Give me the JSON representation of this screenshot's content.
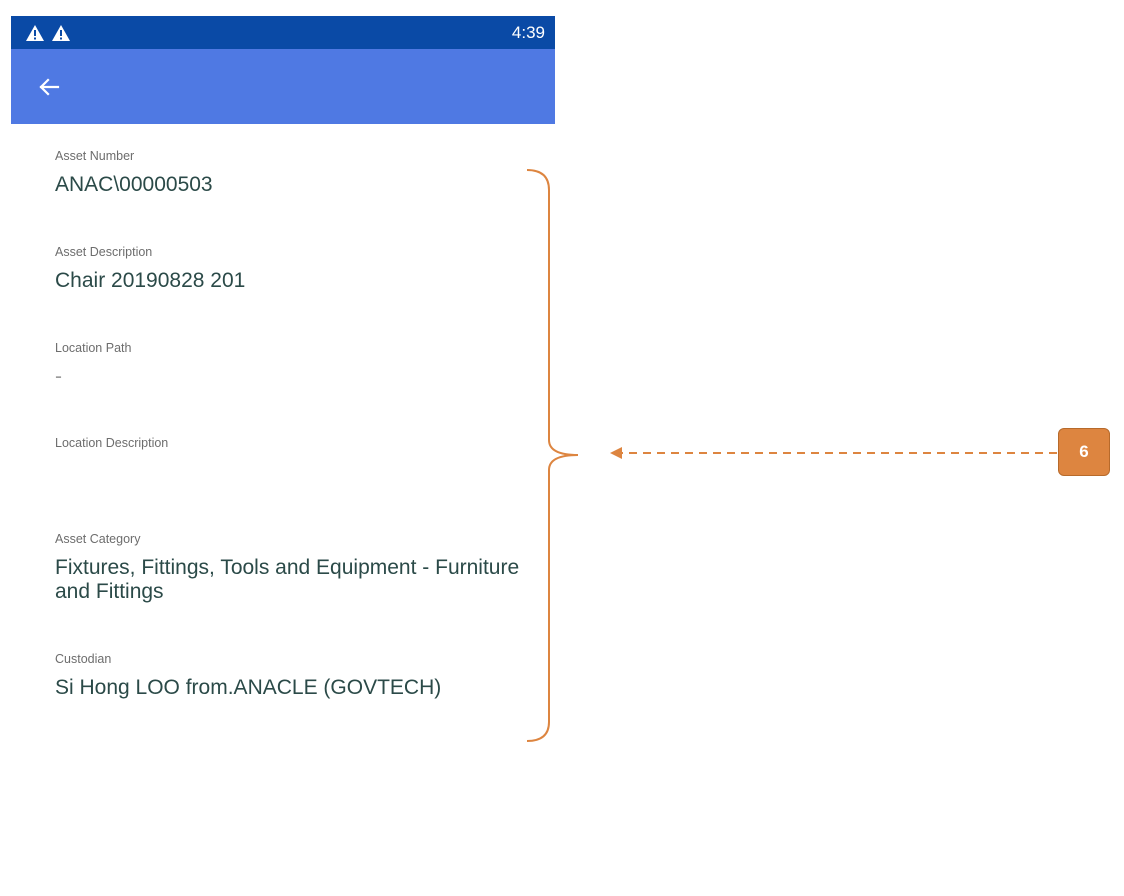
{
  "status_bar": {
    "time": "4:39",
    "icons": [
      "warning-icon",
      "warning-icon"
    ],
    "color": "#0a4aa6"
  },
  "app_bar": {
    "back_icon": "arrow-left-icon",
    "color": "#4f79e3"
  },
  "fields": [
    {
      "label": "Asset Number",
      "value": "ANAC\\00000503"
    },
    {
      "label": "Asset Description",
      "value": "Chair 20190828 201"
    },
    {
      "label": "Location Path",
      "value": "-"
    },
    {
      "label": "Location Description",
      "value": ""
    },
    {
      "label": "Asset Category",
      "value": "Fixtures, Fittings, Tools and Equipment - Furniture and Fittings"
    },
    {
      "label": "Custodian",
      "value": "Si Hong LOO from.ANACLE (GOVTECH)"
    }
  ],
  "annotation": {
    "badge_label": "6",
    "color": "#dd8540"
  }
}
